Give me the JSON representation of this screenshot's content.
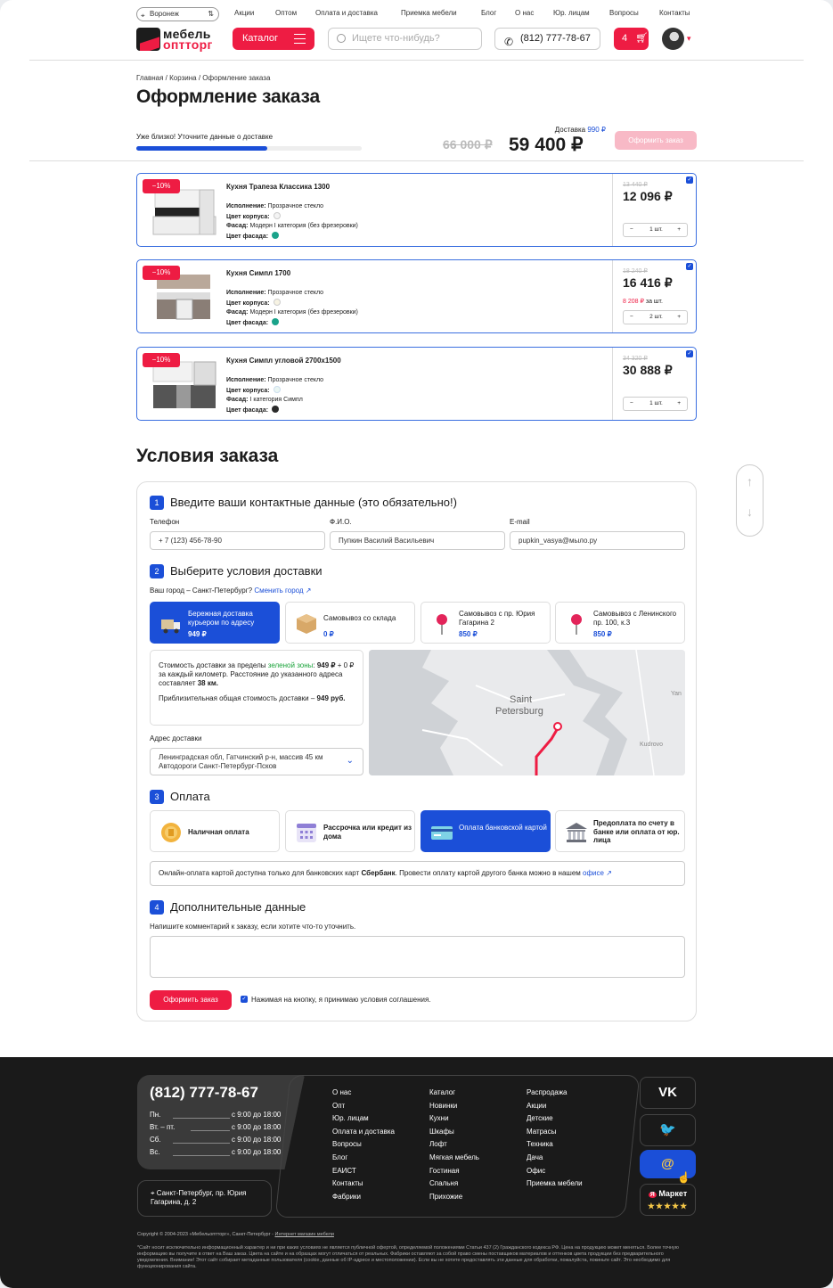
{
  "header": {
    "city": "Воронеж",
    "nav": [
      "Акции",
      "Оптом",
      "Оплата и доставка",
      "Приемка мебели",
      "Блог",
      "О нас",
      "Юр. лицам",
      "Вопросы",
      "Контакты"
    ],
    "logo_line1": "мебель",
    "logo_line2": "оптторг",
    "catalog_label": "Каталог",
    "search_placeholder": "Ищете что-нибудь?",
    "phone": "(812) 777-78-67",
    "cart_count": "4"
  },
  "breadcrumb": "Главная / Корзина / Оформление заказа",
  "page_title": "Оформление заказа",
  "progress": {
    "hint": "Уже близко! Уточните данные о доставке",
    "fraction": 0.58
  },
  "summary": {
    "delivery_label": "Доставка",
    "delivery_value": "990 ₽",
    "old_total": "66 000 ₽",
    "total": "59 400 ₽",
    "order_button": "Оформить заказ"
  },
  "products": [
    {
      "badge": "−10%",
      "name": "Кухня Трапеза Классика 1300",
      "exec_label": "Исполнение:",
      "exec": "Прозрачное стекло",
      "body_label": "Цвет корпуса:",
      "facade_label": "Фасад:",
      "facade": "Модерн I категория (без фрезеровки)",
      "facade_color_label": "Цвет фасада:",
      "body_color": "#f4f4f4",
      "facade_color": "#1aa38a",
      "old_price": "13 440 ₽",
      "price": "12 096 ₽",
      "unit_price": "",
      "unit_suffix": "",
      "qty": "1 шт."
    },
    {
      "badge": "−10%",
      "name": "Кухня Симпл 1700",
      "exec_label": "Исполнение:",
      "exec": "Прозрачное стекло",
      "body_label": "Цвет корпуса:",
      "facade_label": "Фасад:",
      "facade": "Модерн I категория (без фрезеровки)",
      "facade_color_label": "Цвет фасада:",
      "body_color": "#f7f3e3",
      "facade_color": "#1aa38a",
      "old_price": "18 240 ₽",
      "price": "16 416 ₽",
      "unit_price": "8 208 ₽",
      "unit_suffix": " за шт.",
      "qty": "2 шт."
    },
    {
      "badge": "−10%",
      "name": "Кухня Симпл угловой 2700х1500",
      "exec_label": "Исполнение:",
      "exec": "Прозрачное стекло",
      "body_label": "Цвет корпуса:",
      "facade_label": "Фасад:",
      "facade": "I категория Симпл",
      "facade_color_label": "Цвет фасада:",
      "body_color": "#eaf6f3",
      "facade_color": "#2a2a2a",
      "old_price": "34 320 ₽",
      "price": "30 888 ₽",
      "unit_price": "",
      "unit_suffix": "",
      "qty": "1 шт."
    }
  ],
  "conditions_title": "Условия заказа",
  "step1": {
    "num": "1",
    "title": "Введите ваши контактные данные (это обязательно!)",
    "phone_label": "Телефон",
    "phone": "+ 7 (123) 456-78-90",
    "name_label": "Ф.И.О.",
    "name": "Пупкин Василий Васильевич",
    "email_label": "E-mail",
    "email": "pupkin_vasya@мыло.ру"
  },
  "step2": {
    "num": "2",
    "title": "Выберите условия доставки",
    "city_text": "Ваш город – Санкт-Петербург?",
    "change_city": "Сменить город ↗",
    "options": [
      {
        "title": "Бережная доставка курьером по адресу",
        "price": "949 ₽"
      },
      {
        "title": "Самовывоз со склада",
        "price": "0 ₽"
      },
      {
        "title": "Самовывоз с пр. Юрия Гагарина 2",
        "price": "850 ₽"
      },
      {
        "title": "Самовывоз с Ленинского пр. 100,  к.3",
        "price": "850 ₽"
      }
    ],
    "info1": "Стоимость доставки за пределы ",
    "info_zone": "зеленой зоны",
    "info2": ": ",
    "info_price": "949 ₽",
    "info3": " + 0 ₽ за каждый километр. Расстояние до указанного адреса составляет ",
    "info_km": "38 км.",
    "info4": "Приблизительная общая стоимость доставки – ",
    "info_total": "949 руб.",
    "address_label": "Адрес доставки",
    "address": "Ленинградская обл, Гатчинский р-н, массив 45 км Автодороги Санкт-Петербург-Псков",
    "map_city1": "Saint",
    "map_city2": "Petersburg",
    "map_yan": "Yan",
    "map_kudrovo": "Kudrovo"
  },
  "step3": {
    "num": "3",
    "title": "Оплата",
    "options": [
      "Наличная оплата",
      "Рассрочка или кредит из дома",
      "Оплата банковской картой",
      "Предоплата по счету в банке или оплата от юр. лица"
    ],
    "note1": "Онлайн-оплата картой доступна только для банковских карт ",
    "note_bank": "Сбербанк",
    "note2": ". Провести оплату картой другого банка можно в нашем ",
    "note_link": "офисе ↗"
  },
  "step4": {
    "num": "4",
    "title": "Дополнительные данные",
    "comment_label": "Напишите комментарий к заказу, если хотите что-то уточнить.",
    "submit": "Оформить заказ",
    "agree": "Нажимая на кнопку, я принимаю условия соглашения."
  },
  "footer": {
    "phone": "(812) 777-78-67",
    "hours": [
      {
        "day": "Пн.",
        "time": "с 9:00 до 18:00"
      },
      {
        "day": "Вт. – пт.",
        "time": "с 9:00 до 18:00"
      },
      {
        "day": "Сб.",
        "time": "с 9:00 до 18:00"
      },
      {
        "day": "Вс.",
        "time": "с 9:00 до 18:00"
      }
    ],
    "address": "Санкт-Петербург, пр. Юрия Гагарина, д. 2",
    "col1": [
      "О нас",
      "Опт",
      "Юр. лицам",
      "Оплата и доставка",
      "Вопросы",
      "Блог",
      "ЕАИСТ",
      "Контакты",
      "Фабрики"
    ],
    "col2": [
      "Каталог",
      "Новинки",
      "Кухни",
      "Шкафы",
      "Лофт",
      "Мягкая мебель",
      "Гостиная",
      "Спальня",
      "Прихожие"
    ],
    "col3": [
      "Распродажа",
      "Акции",
      "Детские",
      "Матрасы",
      "Техника",
      "Дача",
      "Офис",
      "Приемка мебели"
    ],
    "social": [
      "VK",
      "🐦",
      "@"
    ],
    "market": "Маркет",
    "market_rating": 5,
    "copyright": "Copyright © 2004-2023 «Мебельоптторг», Санкт-Петербург - ",
    "copyright_link": "Интернет магазин мебели",
    "legal": "*Сайт носит исключительно информационный характер и ни при каких условиях не является публичной офертой, определяемой положениями Статьи 437 (2) Гражданского кодекса РФ. Цена на продукцию может меняться. Более точную информацию вы получите в ответ на Ваш заказ. Цвета на сайте и на образцах могут отличаться от реальных. Фабрики оставляют за собой право смены поставщиков материалов и оттенков цвета продукции без предварительного уведомления. Внимание! Этот сайт собирает метаданные пользователя (cookie, данные об IP-адресе и местоположении). Если вы не хотите предоставлять эти данные для обработки, пожалуйста, покиньте сайт. Это необходимо для функционирования сайта."
  }
}
